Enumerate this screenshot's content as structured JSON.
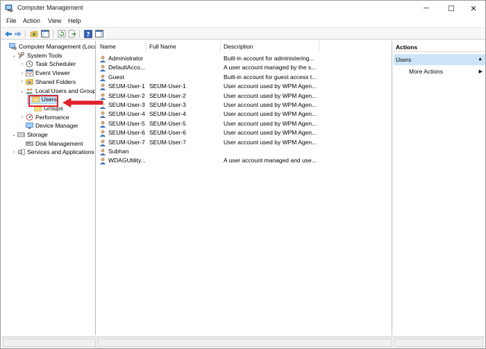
{
  "window": {
    "title": "Computer Management",
    "controls": {
      "minimize": "─",
      "maximize": "☐",
      "close": "✕"
    }
  },
  "menu": [
    "File",
    "Action",
    "View",
    "Help"
  ],
  "tree": [
    {
      "label": "Computer Management (Local",
      "icon": "computer-management-icon",
      "indent": 0,
      "expander": ""
    },
    {
      "label": "System Tools",
      "icon": "tools-icon",
      "indent": 1,
      "expander": "v"
    },
    {
      "label": "Task Scheduler",
      "icon": "clock-icon",
      "indent": 2,
      "expander": ">"
    },
    {
      "label": "Event Viewer",
      "icon": "event-viewer-icon",
      "indent": 2,
      "expander": ">"
    },
    {
      "label": "Shared Folders",
      "icon": "shared-folder-icon",
      "indent": 2,
      "expander": ">"
    },
    {
      "label": "Local Users and Groups",
      "icon": "users-group-icon",
      "indent": 2,
      "expander": "v"
    },
    {
      "label": "Users",
      "icon": "folder-icon",
      "indent": 3,
      "expander": "",
      "selected": true
    },
    {
      "label": "Groups",
      "icon": "folder-icon",
      "indent": 3,
      "expander": ""
    },
    {
      "label": "Performance",
      "icon": "performance-icon",
      "indent": 2,
      "expander": ">"
    },
    {
      "label": "Device Manager",
      "icon": "device-manager-icon",
      "indent": 2,
      "expander": ""
    },
    {
      "label": "Storage",
      "icon": "storage-icon",
      "indent": 1,
      "expander": "v"
    },
    {
      "label": "Disk Management",
      "icon": "disk-icon",
      "indent": 2,
      "expander": ""
    },
    {
      "label": "Services and Applications",
      "icon": "services-icon",
      "indent": 1,
      "expander": ">"
    }
  ],
  "list": {
    "columns": [
      "Name",
      "Full Name",
      "Description"
    ],
    "rows": [
      {
        "name": "Administrator",
        "full_name": "",
        "description": "Built-in account for administering..."
      },
      {
        "name": "DefaultAcco...",
        "full_name": "",
        "description": "A user account managed by the s..."
      },
      {
        "name": "Guest",
        "full_name": "",
        "description": "Built-in account for guest access t..."
      },
      {
        "name": "SEUM-User-1",
        "full_name": "SEUM-User-1",
        "description": "User account used by WPM Agen..."
      },
      {
        "name": "SEUM-User-2",
        "full_name": "SEUM-User-2",
        "description": "User account used by WPM Agen..."
      },
      {
        "name": "SEUM-User-3",
        "full_name": "SEUM-User-3",
        "description": "User account used by WPM Agen..."
      },
      {
        "name": "SEUM-User-4",
        "full_name": "SEUM-User-4",
        "description": "User account used by WPM Agen..."
      },
      {
        "name": "SEUM-User-5",
        "full_name": "SEUM-User-5",
        "description": "User account used by WPM Agen..."
      },
      {
        "name": "SEUM-User-6",
        "full_name": "SEUM-User-6",
        "description": "User account used by WPM Agen..."
      },
      {
        "name": "SEUM-User-7",
        "full_name": "SEUM-User-7",
        "description": "User account used by WPM Agen..."
      },
      {
        "name": "Subhan",
        "full_name": "",
        "description": ""
      },
      {
        "name": "WDAGUtility...",
        "full_name": "",
        "description": "A user account managed and use..."
      }
    ]
  },
  "actions": {
    "header": "Actions",
    "context": "Users",
    "items": [
      "More Actions"
    ]
  },
  "colors": {
    "selection": "#cce8ff",
    "actions_context": "#cce4f7",
    "annotation_red": "#e0222a"
  }
}
